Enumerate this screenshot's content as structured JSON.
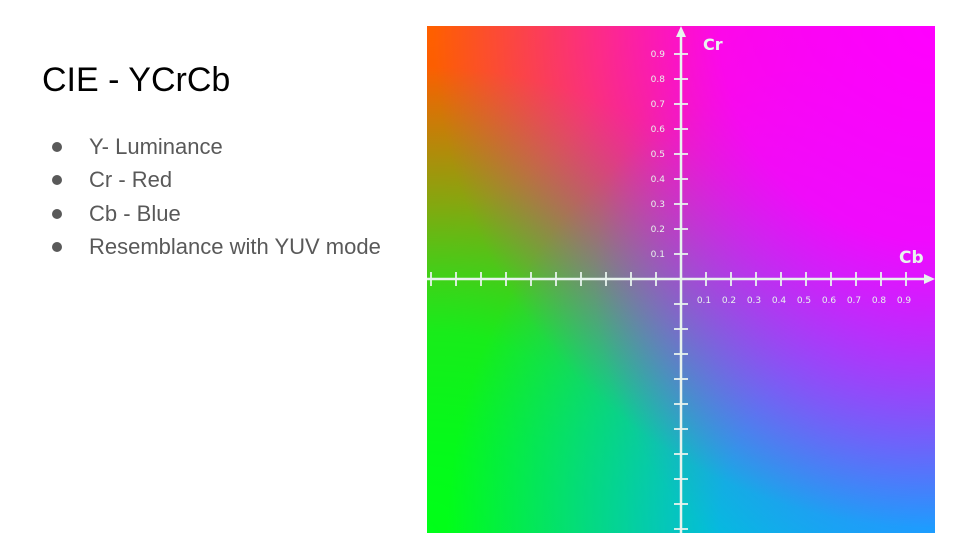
{
  "slide": {
    "title": "CIE - YCrCb",
    "bullets": [
      "Y- Luminance",
      "Cr - Red",
      "Cb - Blue",
      "Resemblance with YUV mode"
    ]
  },
  "diagram": {
    "y_axis_label": "Cr",
    "x_axis_label": "Cb",
    "y_tick_labels": [
      "0.9",
      "0.8",
      "0.7",
      "0.6",
      "0.5",
      "0.4",
      "0.3",
      "0.2",
      "0.1"
    ],
    "x_tick_labels": [
      "0.1",
      "0.2",
      "0.3",
      "0.4",
      "0.5",
      "0.6",
      "0.7",
      "0.8",
      "0.9"
    ],
    "corner_colors": {
      "top_left": "#ff5f00",
      "top_right": "#ff00ff",
      "bottom_left": "#00ff18",
      "bottom_right": "#00b4ff"
    },
    "axis_color": "#e8f4ee"
  }
}
